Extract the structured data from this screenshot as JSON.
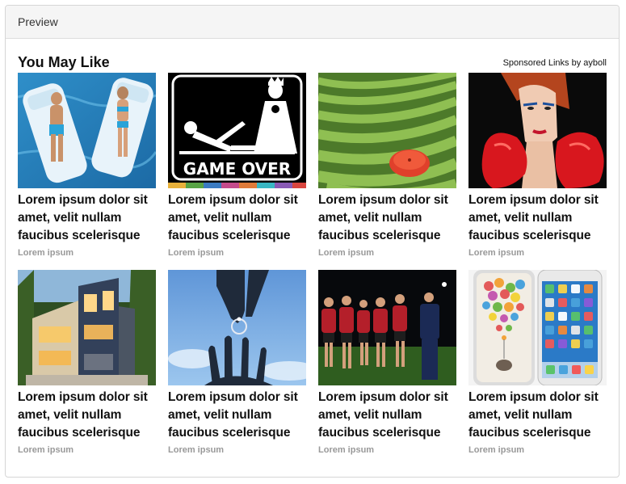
{
  "panel": {
    "header_title": "Preview"
  },
  "widget": {
    "title": "You May Like",
    "sponsored": "Sponsored Links by ayboll"
  },
  "cards": [
    {
      "image": "pool-floats-couple-image",
      "title": "Lorem ipsum dolor sit amet, velit nullam faucibus scelerisque",
      "source": "Lorem ipsum"
    },
    {
      "image": "game-over-wedding-image",
      "title": "Lorem ipsum dolor sit amet, velit nullam faucibus scelerisque",
      "source": "Lorem ipsum",
      "image_text": "GAME OVER"
    },
    {
      "image": "tea-field-umbrella-image",
      "title": "Lorem ipsum dolor sit amet, velit nullam faucibus scelerisque",
      "source": "Lorem ipsum"
    },
    {
      "image": "boxing-gloves-woman-image",
      "title": "Lorem ipsum dolor sit amet, velit nullam faucibus scelerisque",
      "source": "Lorem ipsum"
    },
    {
      "image": "modern-house-image",
      "title": "Lorem ipsum dolor sit amet, velit nullam faucibus scelerisque",
      "source": "Lorem ipsum"
    },
    {
      "image": "ring-in-sky-image",
      "title": "Lorem ipsum dolor sit amet, velit nullam faucibus scelerisque",
      "source": "Lorem ipsum"
    },
    {
      "image": "rugby-team-image",
      "title": "Lorem ipsum dolor sit amet, velit nullam faucibus scelerisque",
      "source": "Lorem ipsum"
    },
    {
      "image": "iphones-image",
      "title": "Lorem ipsum dolor sit amet, velit nullam faucibus scelerisque",
      "source": "Lorem ipsum"
    }
  ]
}
